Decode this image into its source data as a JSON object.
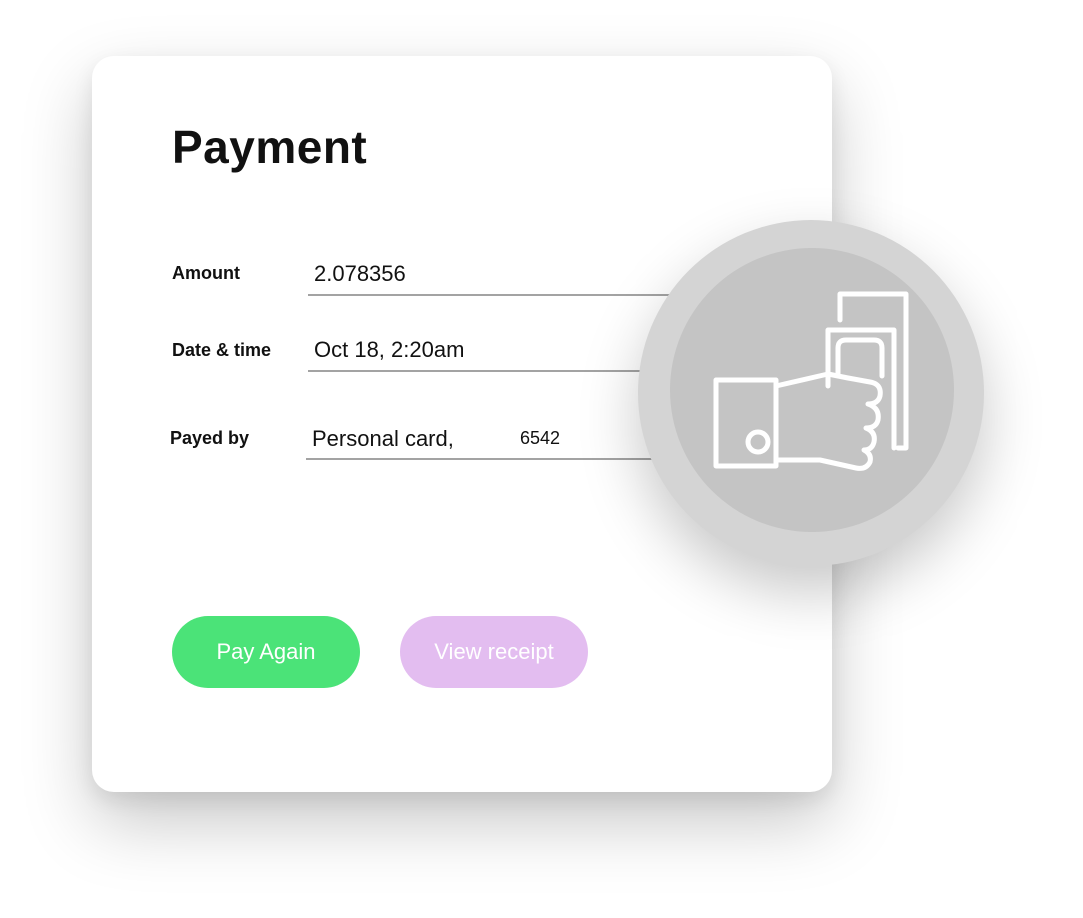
{
  "payment": {
    "title": "Payment",
    "fields": [
      {
        "label": "Amount",
        "value": "2.078356"
      },
      {
        "label": "Date & time",
        "value": "Oct 18, 2:20am"
      },
      {
        "label": "Payed by",
        "value": "Personal card,",
        "extra": "6542"
      }
    ],
    "buttons": {
      "pay_again": "Pay Again",
      "view_receipt": "View receipt"
    },
    "badge": {
      "icon": "hand-holding-cash-icon"
    }
  },
  "colors": {
    "pay_again_bg": "#4be378",
    "view_receipt_bg": "#e3bdf0",
    "badge_outer": "#d4d4d4",
    "badge_inner": "#c4c4c4",
    "underline": "#a3a3a3"
  }
}
